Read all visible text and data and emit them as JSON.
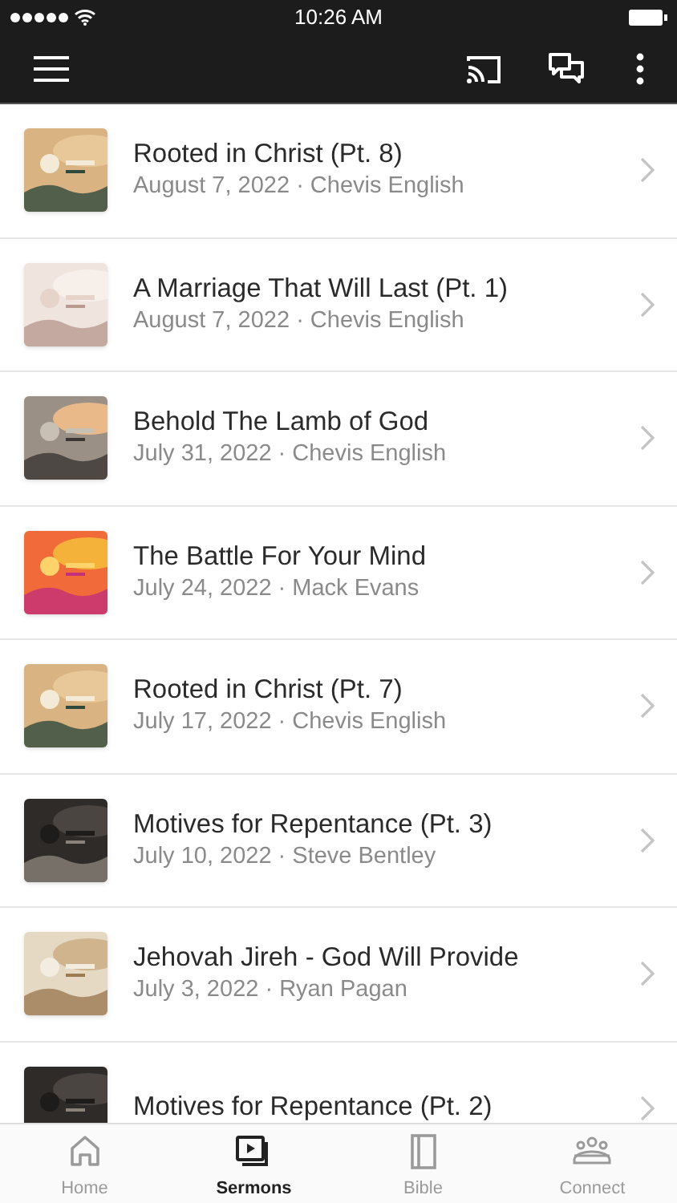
{
  "status_bar": {
    "time": "10:26 AM"
  },
  "sermons": [
    {
      "title": "Rooted in Christ (Pt. 8)",
      "subtitle": "August 7, 2022 · Chevis English"
    },
    {
      "title": "A Marriage That Will Last (Pt. 1)",
      "subtitle": "August 7, 2022 · Chevis English"
    },
    {
      "title": "Behold The Lamb of God",
      "subtitle": "July 31, 2022 · Chevis English"
    },
    {
      "title": "The Battle For Your Mind",
      "subtitle": "July 24, 2022 · Mack Evans"
    },
    {
      "title": "Rooted in Christ (Pt. 7)",
      "subtitle": "July 17, 2022 · Chevis English"
    },
    {
      "title": "Motives for Repentance (Pt. 3)",
      "subtitle": "July 10, 2022 · Steve Bentley"
    },
    {
      "title": "Jehovah Jireh - God Will Provide",
      "subtitle": "July 3, 2022 · Ryan Pagan"
    },
    {
      "title": "Motives for Repentance (Pt. 2)"
    }
  ],
  "tab_bar": [
    {
      "label": "Home",
      "kind": "home",
      "selected": false
    },
    {
      "label": "Sermons",
      "kind": "sermons",
      "selected": true
    },
    {
      "label": "Bible",
      "kind": "bible",
      "selected": false
    },
    {
      "label": "Connect",
      "kind": "connect",
      "selected": false
    }
  ]
}
